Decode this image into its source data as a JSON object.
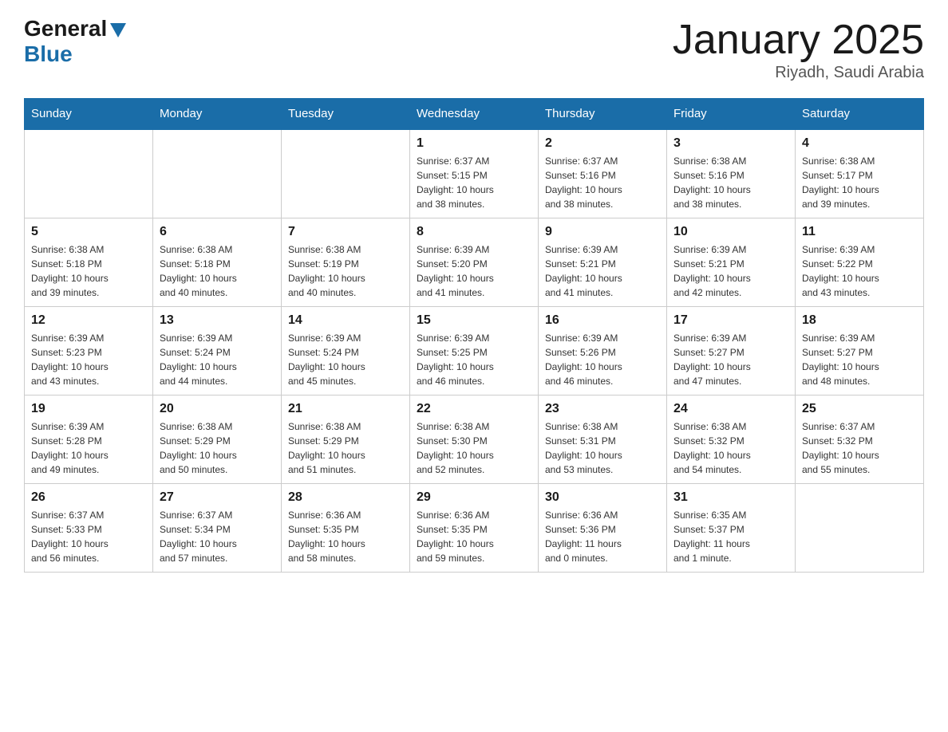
{
  "header": {
    "logo_general": "General",
    "logo_blue": "Blue",
    "month_title": "January 2025",
    "location": "Riyadh, Saudi Arabia"
  },
  "days_of_week": [
    "Sunday",
    "Monday",
    "Tuesday",
    "Wednesday",
    "Thursday",
    "Friday",
    "Saturday"
  ],
  "weeks": [
    [
      {
        "day": "",
        "info": ""
      },
      {
        "day": "",
        "info": ""
      },
      {
        "day": "",
        "info": ""
      },
      {
        "day": "1",
        "info": "Sunrise: 6:37 AM\nSunset: 5:15 PM\nDaylight: 10 hours\nand 38 minutes."
      },
      {
        "day": "2",
        "info": "Sunrise: 6:37 AM\nSunset: 5:16 PM\nDaylight: 10 hours\nand 38 minutes."
      },
      {
        "day": "3",
        "info": "Sunrise: 6:38 AM\nSunset: 5:16 PM\nDaylight: 10 hours\nand 38 minutes."
      },
      {
        "day": "4",
        "info": "Sunrise: 6:38 AM\nSunset: 5:17 PM\nDaylight: 10 hours\nand 39 minutes."
      }
    ],
    [
      {
        "day": "5",
        "info": "Sunrise: 6:38 AM\nSunset: 5:18 PM\nDaylight: 10 hours\nand 39 minutes."
      },
      {
        "day": "6",
        "info": "Sunrise: 6:38 AM\nSunset: 5:18 PM\nDaylight: 10 hours\nand 40 minutes."
      },
      {
        "day": "7",
        "info": "Sunrise: 6:38 AM\nSunset: 5:19 PM\nDaylight: 10 hours\nand 40 minutes."
      },
      {
        "day": "8",
        "info": "Sunrise: 6:39 AM\nSunset: 5:20 PM\nDaylight: 10 hours\nand 41 minutes."
      },
      {
        "day": "9",
        "info": "Sunrise: 6:39 AM\nSunset: 5:21 PM\nDaylight: 10 hours\nand 41 minutes."
      },
      {
        "day": "10",
        "info": "Sunrise: 6:39 AM\nSunset: 5:21 PM\nDaylight: 10 hours\nand 42 minutes."
      },
      {
        "day": "11",
        "info": "Sunrise: 6:39 AM\nSunset: 5:22 PM\nDaylight: 10 hours\nand 43 minutes."
      }
    ],
    [
      {
        "day": "12",
        "info": "Sunrise: 6:39 AM\nSunset: 5:23 PM\nDaylight: 10 hours\nand 43 minutes."
      },
      {
        "day": "13",
        "info": "Sunrise: 6:39 AM\nSunset: 5:24 PM\nDaylight: 10 hours\nand 44 minutes."
      },
      {
        "day": "14",
        "info": "Sunrise: 6:39 AM\nSunset: 5:24 PM\nDaylight: 10 hours\nand 45 minutes."
      },
      {
        "day": "15",
        "info": "Sunrise: 6:39 AM\nSunset: 5:25 PM\nDaylight: 10 hours\nand 46 minutes."
      },
      {
        "day": "16",
        "info": "Sunrise: 6:39 AM\nSunset: 5:26 PM\nDaylight: 10 hours\nand 46 minutes."
      },
      {
        "day": "17",
        "info": "Sunrise: 6:39 AM\nSunset: 5:27 PM\nDaylight: 10 hours\nand 47 minutes."
      },
      {
        "day": "18",
        "info": "Sunrise: 6:39 AM\nSunset: 5:27 PM\nDaylight: 10 hours\nand 48 minutes."
      }
    ],
    [
      {
        "day": "19",
        "info": "Sunrise: 6:39 AM\nSunset: 5:28 PM\nDaylight: 10 hours\nand 49 minutes."
      },
      {
        "day": "20",
        "info": "Sunrise: 6:38 AM\nSunset: 5:29 PM\nDaylight: 10 hours\nand 50 minutes."
      },
      {
        "day": "21",
        "info": "Sunrise: 6:38 AM\nSunset: 5:29 PM\nDaylight: 10 hours\nand 51 minutes."
      },
      {
        "day": "22",
        "info": "Sunrise: 6:38 AM\nSunset: 5:30 PM\nDaylight: 10 hours\nand 52 minutes."
      },
      {
        "day": "23",
        "info": "Sunrise: 6:38 AM\nSunset: 5:31 PM\nDaylight: 10 hours\nand 53 minutes."
      },
      {
        "day": "24",
        "info": "Sunrise: 6:38 AM\nSunset: 5:32 PM\nDaylight: 10 hours\nand 54 minutes."
      },
      {
        "day": "25",
        "info": "Sunrise: 6:37 AM\nSunset: 5:32 PM\nDaylight: 10 hours\nand 55 minutes."
      }
    ],
    [
      {
        "day": "26",
        "info": "Sunrise: 6:37 AM\nSunset: 5:33 PM\nDaylight: 10 hours\nand 56 minutes."
      },
      {
        "day": "27",
        "info": "Sunrise: 6:37 AM\nSunset: 5:34 PM\nDaylight: 10 hours\nand 57 minutes."
      },
      {
        "day": "28",
        "info": "Sunrise: 6:36 AM\nSunset: 5:35 PM\nDaylight: 10 hours\nand 58 minutes."
      },
      {
        "day": "29",
        "info": "Sunrise: 6:36 AM\nSunset: 5:35 PM\nDaylight: 10 hours\nand 59 minutes."
      },
      {
        "day": "30",
        "info": "Sunrise: 6:36 AM\nSunset: 5:36 PM\nDaylight: 11 hours\nand 0 minutes."
      },
      {
        "day": "31",
        "info": "Sunrise: 6:35 AM\nSunset: 5:37 PM\nDaylight: 11 hours\nand 1 minute."
      },
      {
        "day": "",
        "info": ""
      }
    ]
  ]
}
